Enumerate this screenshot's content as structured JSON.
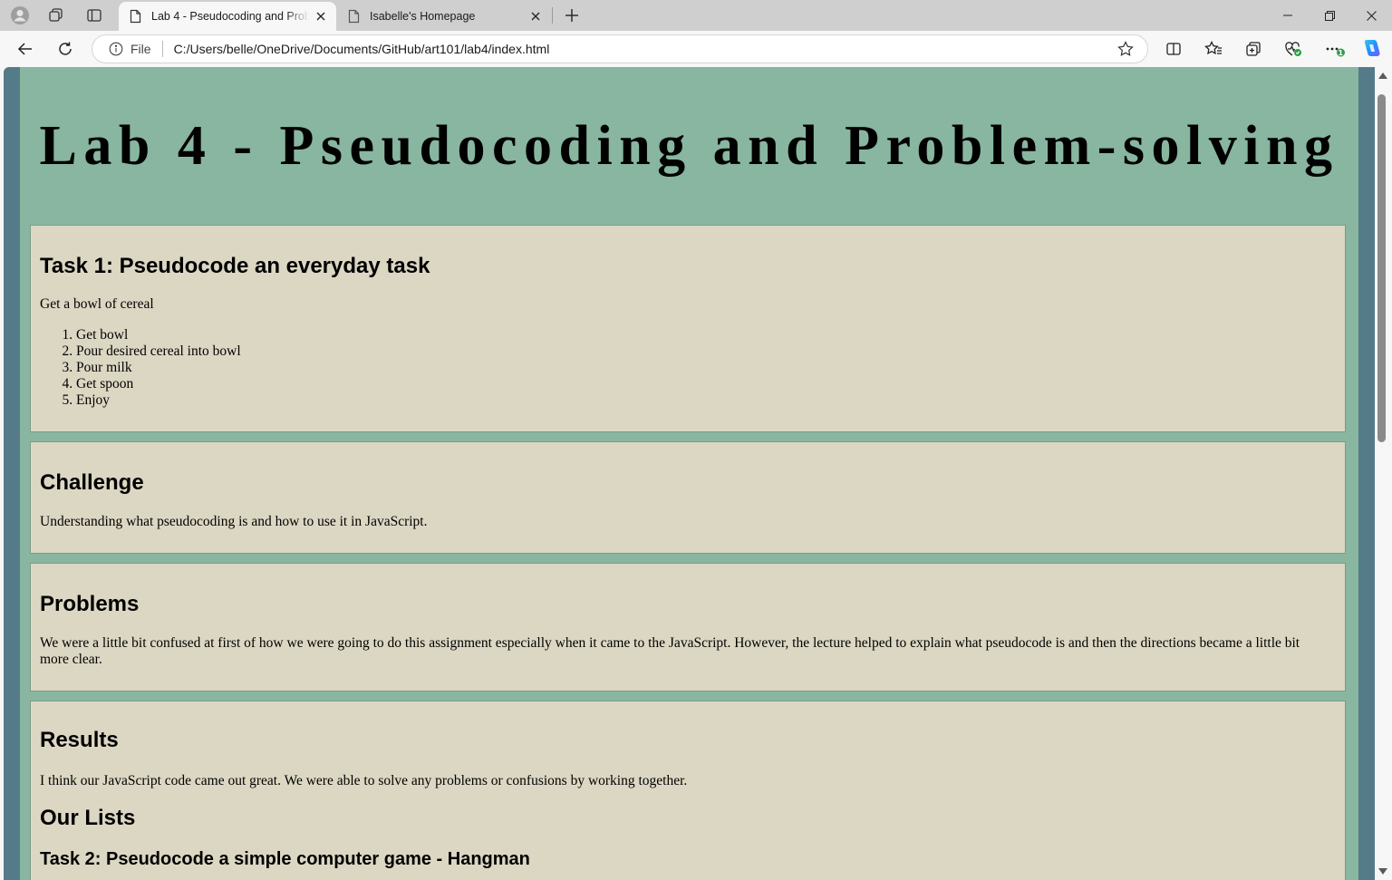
{
  "browser": {
    "tabs": [
      {
        "title": "Lab 4 - Pseudocoding and Problem-solving",
        "active": true
      },
      {
        "title": "Isabelle's Homepage",
        "active": false
      }
    ],
    "address": {
      "scheme_label": "File",
      "url": "C:/Users/belle/OneDrive/Documents/GitHub/art101/lab4/index.html"
    },
    "extension_badge": "1"
  },
  "page": {
    "title": "Lab 4 - Pseudocoding and Problem-solving",
    "task1": {
      "heading": "Task 1: Pseudocode an everyday task",
      "intro": "Get a bowl of cereal",
      "steps": [
        "Get bowl",
        "Pour desired cereal into bowl",
        "Pour milk",
        "Get spoon",
        "Enjoy"
      ]
    },
    "challenge": {
      "heading": "Challenge",
      "text": "Understanding what pseudocoding is and how to use it in JavaScript."
    },
    "problems": {
      "heading": "Problems",
      "text": "We were a little bit confused at first of how we were going to do this assignment especially when it came to the JavaScript. However, the lecture helped to explain what pseudocode is and then the directions became a little bit more clear."
    },
    "results": {
      "heading": "Results",
      "text": "I think our JavaScript code came out great. We were able to solve any problems or confusions by working together.",
      "lists_heading": "Our Lists",
      "task2_heading": "Task 2: Pseudocode a simple computer game - Hangman"
    }
  },
  "colors": {
    "page_background": "#88b6a0",
    "frame_background": "#567b88",
    "section_background": "#dcd7c3",
    "copilot_accent": "#1f8fff"
  }
}
